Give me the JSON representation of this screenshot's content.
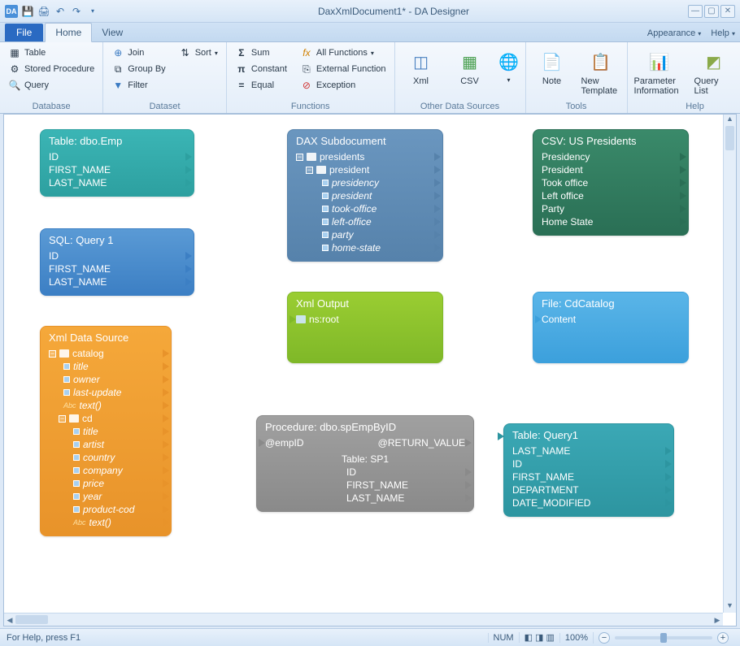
{
  "title": "DaxXmlDocument1* - DA Designer",
  "tabs": {
    "file": "File",
    "home": "Home",
    "view": "View",
    "appearance": "Appearance",
    "help": "Help"
  },
  "ribbon": {
    "database": {
      "label": "Database",
      "table": "Table",
      "sp": "Stored Procedure",
      "query": "Query"
    },
    "dataset": {
      "label": "Dataset",
      "join": "Join",
      "groupby": "Group By",
      "filter": "Filter",
      "sort": "Sort"
    },
    "functions": {
      "label": "Functions",
      "sum": "Sum",
      "constant": "Constant",
      "equal": "Equal",
      "allfn": "All Functions",
      "extfn": "External Function",
      "exception": "Exception"
    },
    "other": {
      "label": "Other Data Sources",
      "xml": "Xml",
      "csv": "CSV"
    },
    "tools": {
      "label": "Tools",
      "note": "Note",
      "newtpl": "New Template"
    },
    "helpg": {
      "label": "Help",
      "param": "Parameter Information",
      "qlist": "Query List"
    }
  },
  "nodes": {
    "emp": {
      "title": "Table: dbo.Emp",
      "rows": [
        "ID",
        "FIRST_NAME",
        "LAST_NAME"
      ]
    },
    "sql": {
      "title": "SQL: Query 1",
      "rows": [
        "ID",
        "FIRST_NAME",
        "LAST_NAME"
      ]
    },
    "dax": {
      "title": "DAX Subdocument",
      "root": "presidents",
      "child": "president",
      "leaves": [
        "presidency",
        "president",
        "took-office",
        "left-office",
        "party",
        "home-state"
      ]
    },
    "csv": {
      "title": "CSV: US Presidents",
      "rows": [
        "Presidency",
        "President",
        "Took office",
        "Left office",
        "Party",
        "Home State"
      ]
    },
    "xmlsrc": {
      "title": "Xml Data Source",
      "root": "catalog",
      "l1": [
        "title",
        "owner",
        "last-update",
        "text()",
        "cd"
      ],
      "cd": [
        "title",
        "artist",
        "country",
        "company",
        "price",
        "year",
        "product-cod",
        "text()"
      ]
    },
    "xmlout": {
      "title": "Xml Output",
      "row": "ns:root"
    },
    "file": {
      "title": "File: CdCatalog",
      "row": "Content"
    },
    "proc": {
      "title": "Procedure: dbo.spEmpByID",
      "p1": "@empID",
      "p2": "@RETURN_VALUE",
      "sub": "Table: SP1",
      "rows": [
        "ID",
        "FIRST_NAME",
        "LAST_NAME"
      ]
    },
    "q1": {
      "title": "Table: Query1",
      "rows": [
        "LAST_NAME",
        "ID",
        "FIRST_NAME",
        "DEPARTMENT",
        "DATE_MODIFIED"
      ]
    }
  },
  "status": {
    "help": "For Help, press F1",
    "num": "NUM",
    "zoom": "100%"
  }
}
